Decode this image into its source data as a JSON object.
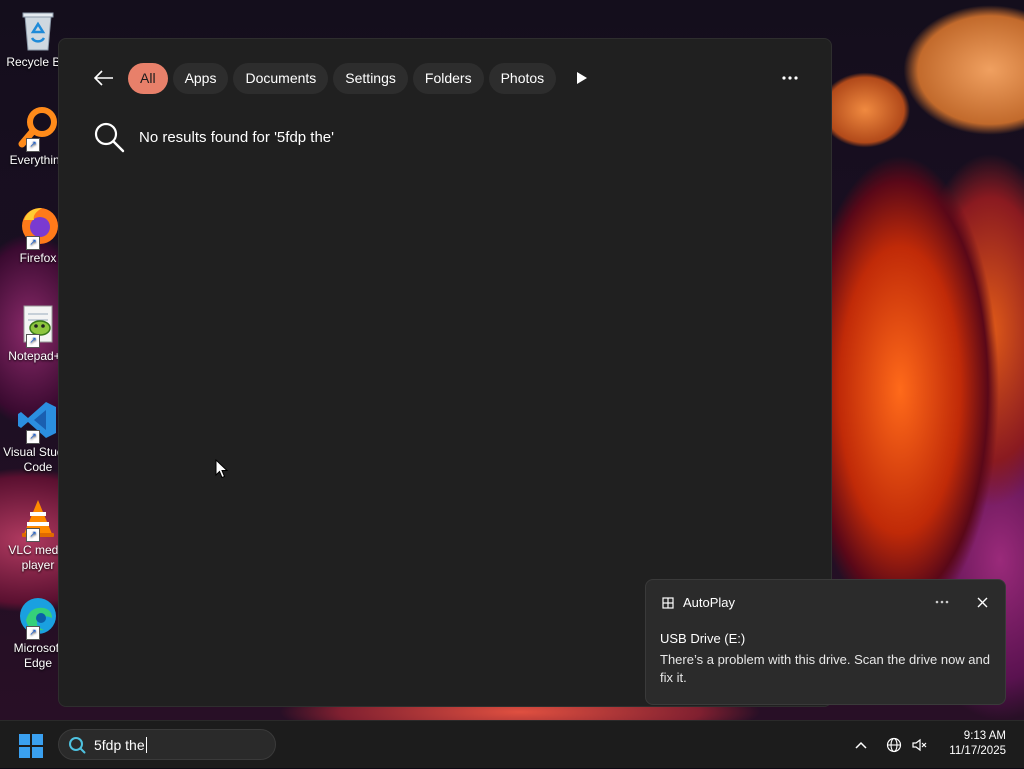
{
  "desktop": {
    "icons": [
      {
        "label": "Recycle Bin",
        "icon": "recycle-bin-icon"
      },
      {
        "label": "Everything",
        "icon": "everything-icon"
      },
      {
        "label": "Firefox",
        "icon": "firefox-icon"
      },
      {
        "label": "Notepad++",
        "icon": "notepad-plus-plus-icon"
      },
      {
        "label": "Visual Studio Code",
        "icon": "vscode-icon"
      },
      {
        "label": "VLC media player",
        "icon": "vlc-icon"
      },
      {
        "label": "Microsoft Edge",
        "icon": "edge-icon"
      }
    ]
  },
  "search_panel": {
    "filters": [
      {
        "label": "All",
        "active": true
      },
      {
        "label": "Apps",
        "active": false
      },
      {
        "label": "Documents",
        "active": false
      },
      {
        "label": "Settings",
        "active": false
      },
      {
        "label": "Folders",
        "active": false
      },
      {
        "label": "Photos",
        "active": false
      }
    ],
    "no_results_text": "No results found for '5fdp the'",
    "accent_color": "#e8806a"
  },
  "toast": {
    "app_name": "AutoPlay",
    "title": "USB Drive (E:)",
    "body": "There’s a problem with this drive.  Scan the drive now and fix it."
  },
  "taskbar": {
    "search_value": "5fdp the",
    "time": "9:13 AM",
    "date": "11/17/2025"
  }
}
